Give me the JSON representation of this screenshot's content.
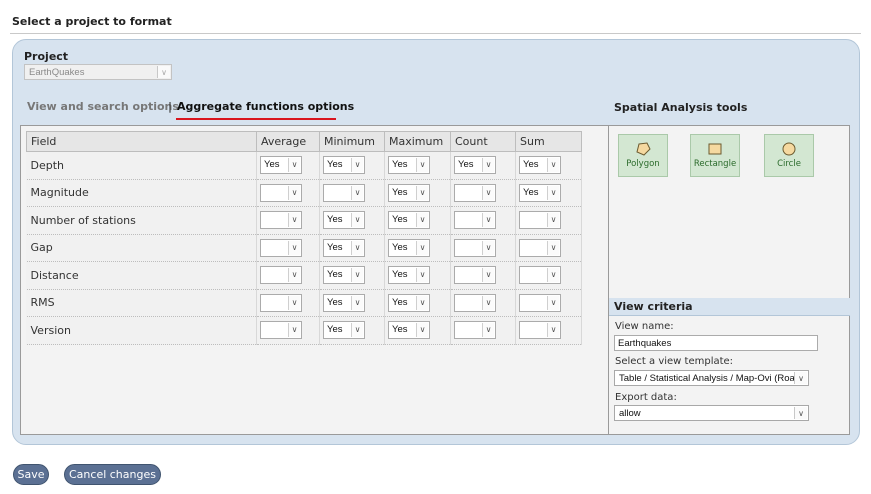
{
  "header": {
    "title": "Select a project to format"
  },
  "project": {
    "label": "Project",
    "selected": "EarthQuakes"
  },
  "tabs": [
    {
      "label": "View and search options",
      "active": false
    },
    {
      "label": "|"
    },
    {
      "label": "Aggregate functions options",
      "active": true
    }
  ],
  "aggregate": {
    "columns": [
      "Field",
      "Average",
      "Minimum",
      "Maximum",
      "Count",
      "Sum"
    ],
    "rows": [
      {
        "field": "Depth",
        "values": [
          "Yes",
          "Yes",
          "Yes",
          "Yes",
          "Yes"
        ]
      },
      {
        "field": "Magnitude",
        "values": [
          "",
          "",
          "Yes",
          "",
          "Yes"
        ]
      },
      {
        "field": "Number of stations",
        "values": [
          "",
          "Yes",
          "Yes",
          "",
          ""
        ]
      },
      {
        "field": "Gap",
        "values": [
          "",
          "Yes",
          "Yes",
          "",
          ""
        ]
      },
      {
        "field": "Distance",
        "values": [
          "",
          "Yes",
          "Yes",
          "",
          ""
        ]
      },
      {
        "field": "RMS",
        "values": [
          "",
          "Yes",
          "Yes",
          "",
          ""
        ]
      },
      {
        "field": "Version",
        "values": [
          "",
          "Yes",
          "Yes",
          "",
          ""
        ]
      }
    ]
  },
  "spatial": {
    "title": "Spatial Analysis tools",
    "tools": [
      {
        "label": "Polygon",
        "icon": "polygon-icon"
      },
      {
        "label": "Rectangle",
        "icon": "rectangle-icon"
      },
      {
        "label": "Circle",
        "icon": "circle-icon"
      }
    ]
  },
  "view_criteria": {
    "title": "View criteria",
    "view_name_label": "View name:",
    "view_name_value": "Earthquakes",
    "template_label": "Select a view template:",
    "template_value": "Table / Statistical Analysis / Map-Ovi (Roa",
    "export_label": "Export data:",
    "export_value": "allow"
  },
  "footer": {
    "save": "Save",
    "cancel": "Cancel changes"
  },
  "colors": {
    "panel": "#d7e3ef",
    "tool_bg": "#d3e7d2",
    "tab_underline": "#d9151e",
    "button": "#5b7093"
  }
}
